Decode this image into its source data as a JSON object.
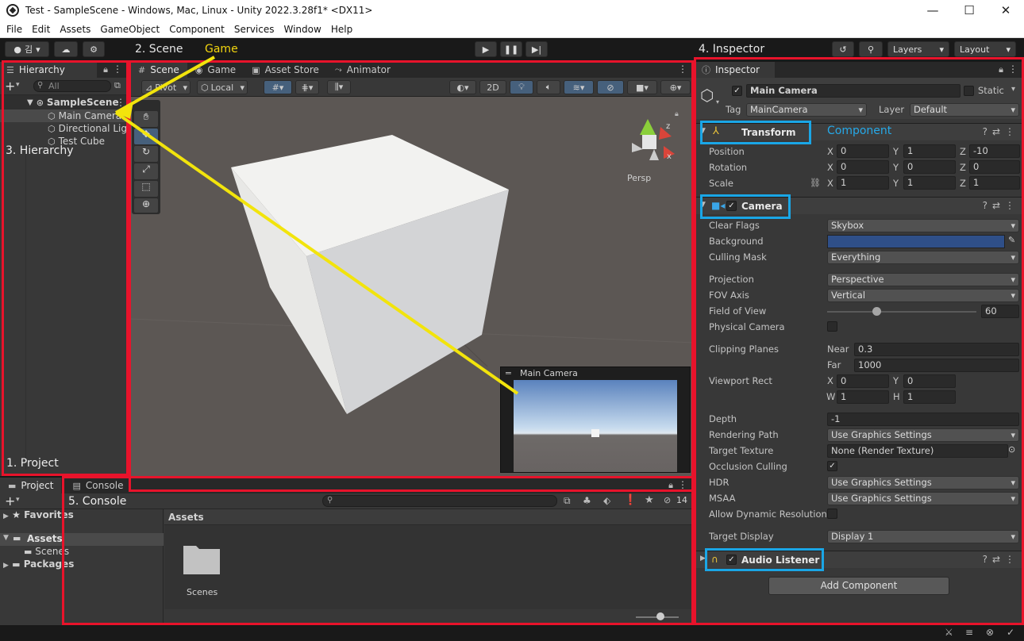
{
  "window": {
    "title": "Test - SampleScene - Windows, Mac, Linux - Unity 2022.3.28f1* <DX11>",
    "controls": [
      "—",
      "☐",
      "✕"
    ]
  },
  "menu": [
    "File",
    "Edit",
    "Assets",
    "GameObject",
    "Component",
    "Services",
    "Window",
    "Help"
  ],
  "toolbar": {
    "account": "김",
    "layers": "Layers",
    "layout": "Layout"
  },
  "annotations": {
    "scene": "2. Scene",
    "game": "Game",
    "inspector": "4. Inspector",
    "hierarchy": "3. Hierarchy",
    "project": "1. Project",
    "console": "5. Console",
    "component": "Component"
  },
  "hierarchy": {
    "tab": "Hierarchy",
    "search_placeholder": "All",
    "scene": "SampleScene",
    "items": [
      "Main Camera",
      "Directional Light",
      "Test Cube"
    ]
  },
  "scene_tabs": [
    "Scene",
    "Game",
    "Asset Store",
    "Animator"
  ],
  "scene_toolbar": {
    "pivot": "Pivot",
    "local": "Local",
    "mode2d": "2D",
    "persp": "Persp"
  },
  "camera_preview": {
    "title": "Main Camera"
  },
  "project": {
    "tabs": [
      "Project",
      "Console"
    ],
    "tree": {
      "favorites": "Favorites",
      "assets": "Assets",
      "scenes": "Scenes",
      "packages": "Packages"
    },
    "breadcrumb": "Assets",
    "folder": "Scenes",
    "hidden_count": "14"
  },
  "inspector": {
    "tab": "Inspector",
    "object_name": "Main Camera",
    "static_label": "Static",
    "tag_label": "Tag",
    "tag_value": "MainCamera",
    "layer_label": "Layer",
    "layer_value": "Default",
    "transform": {
      "title": "Transform",
      "position_label": "Position",
      "rotation_label": "Rotation",
      "scale_label": "Scale",
      "position": [
        "0",
        "1",
        "-10"
      ],
      "rotation": [
        "0",
        "0",
        "0"
      ],
      "scale": [
        "1",
        "1",
        "1"
      ],
      "axes": [
        "X",
        "Y",
        "Z"
      ]
    },
    "camera": {
      "title": "Camera",
      "clear_flags_label": "Clear Flags",
      "clear_flags": "Skybox",
      "background_label": "Background",
      "background_color": "#2f4f88",
      "culling_mask_label": "Culling Mask",
      "culling_mask": "Everything",
      "projection_label": "Projection",
      "projection": "Perspective",
      "fov_axis_label": "FOV Axis",
      "fov_axis": "Vertical",
      "fov_label": "Field of View",
      "fov_value": "60",
      "fov_fraction": 0.33,
      "physical_label": "Physical Camera",
      "clipping_label": "Clipping Planes",
      "near_label": "Near",
      "near": "0.3",
      "far_label": "Far",
      "far": "1000",
      "viewport_label": "Viewport Rect",
      "vx_label": "X",
      "vx": "0",
      "vy_label": "Y",
      "vy": "0",
      "vw_label": "W",
      "vw": "1",
      "vh_label": "H",
      "vh": "1",
      "depth_label": "Depth",
      "depth": "-1",
      "rendering_path_label": "Rendering Path",
      "rendering_path": "Use Graphics Settings",
      "target_texture_label": "Target Texture",
      "target_texture": "None (Render Texture)",
      "occlusion_label": "Occlusion Culling",
      "hdr_label": "HDR",
      "hdr": "Use Graphics Settings",
      "msaa_label": "MSAA",
      "msaa": "Use Graphics Settings",
      "dyn_res_label": "Allow Dynamic Resolution",
      "target_display_label": "Target Display",
      "target_display": "Display 1"
    },
    "audio_listener": {
      "title": "Audio Listener"
    },
    "add_component": "Add Component"
  },
  "colors": {
    "annotation_red": "#e8132b",
    "annotation_blue": "#1aa6e6",
    "annotation_yellow": "#f2e40c"
  }
}
